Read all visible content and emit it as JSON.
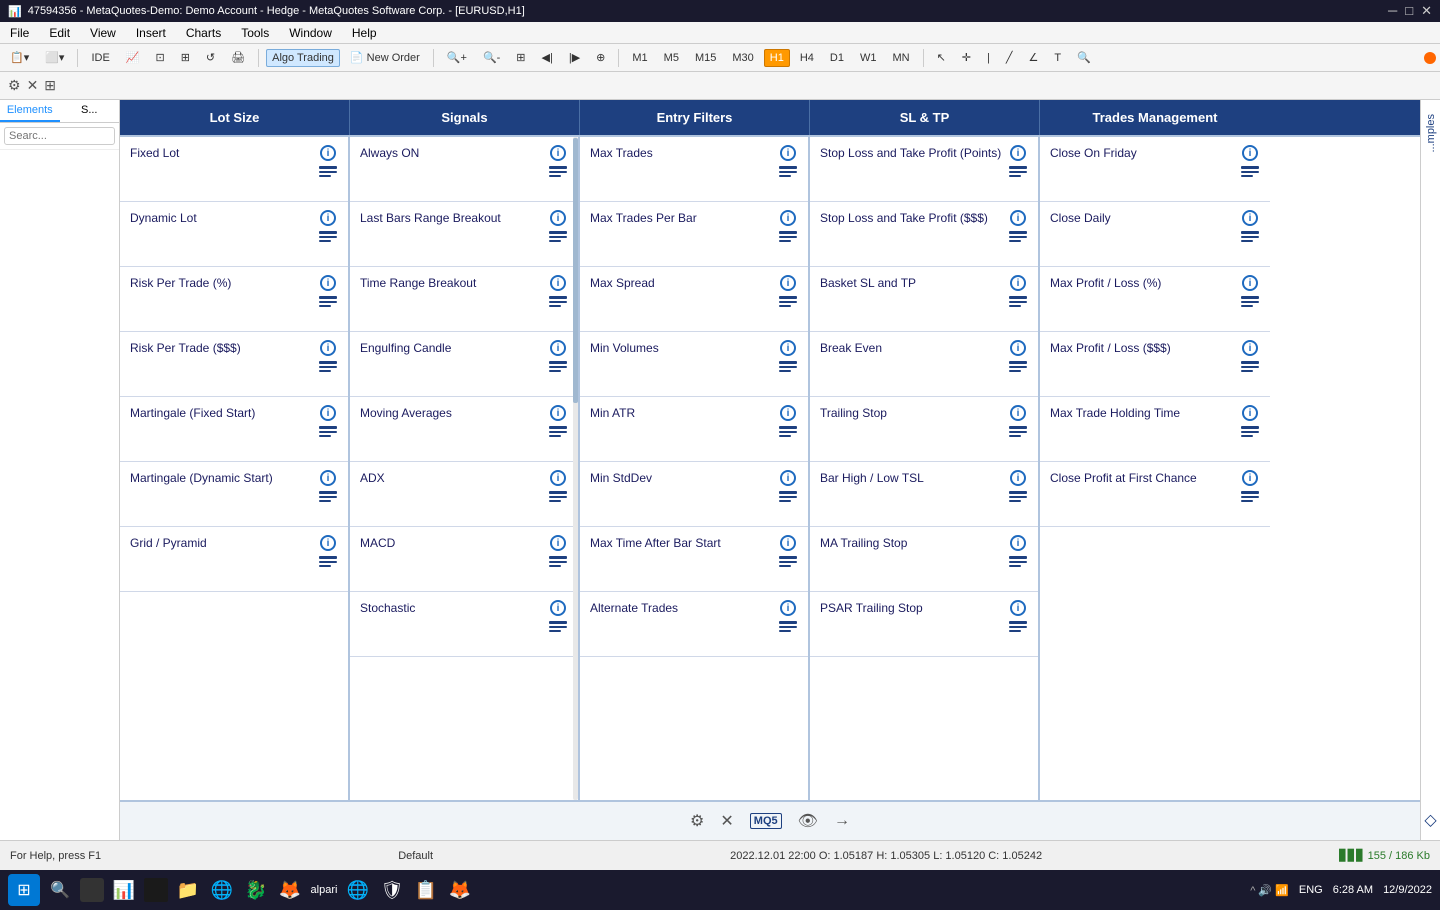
{
  "titleBar": {
    "title": "47594356 - MetaQuotes-Demo: Demo Account - Hedge - MetaQuotes Software Corp. - [EURUSD,H1]",
    "controls": [
      "─",
      "□",
      "✕"
    ]
  },
  "menuBar": {
    "items": [
      "File",
      "Edit",
      "View",
      "Insert",
      "Charts",
      "Tools",
      "Window",
      "Help"
    ]
  },
  "toolbar": {
    "timeframes": [
      "M1",
      "M5",
      "M15",
      "M30",
      "H1",
      "H4",
      "D1",
      "W1",
      "MN"
    ],
    "activeTimeframe": "H1",
    "buttons": [
      "Algo Trading",
      "New Order"
    ]
  },
  "sidebar": {
    "tabs": [
      "Elements",
      "S..."
    ],
    "searchPlaceholder": "Searc..."
  },
  "columns": {
    "headers": [
      "Lot Size",
      "Signals",
      "Entry Filters",
      "SL & TP",
      "Trades Management"
    ]
  },
  "lotSize": {
    "cells": [
      {
        "label": "Fixed Lot"
      },
      {
        "label": "Dynamic Lot"
      },
      {
        "label": "Risk Per Trade (%)"
      },
      {
        "label": "Risk Per Trade ($$$)"
      },
      {
        "label": "Martingale (Fixed Start)"
      },
      {
        "label": "Martingale (Dynamic Start)"
      },
      {
        "label": "Grid / Pyramid"
      }
    ]
  },
  "signals": {
    "cells": [
      {
        "label": "Always ON"
      },
      {
        "label": "Last Bars Range Breakout"
      },
      {
        "label": "Time Range Breakout"
      },
      {
        "label": "Engulfing Candle"
      },
      {
        "label": "Moving Averages"
      },
      {
        "label": "ADX"
      },
      {
        "label": "MACD"
      },
      {
        "label": "Stochastic"
      }
    ]
  },
  "entryFilters": {
    "cells": [
      {
        "label": "Max Trades"
      },
      {
        "label": "Max Trades Per Bar"
      },
      {
        "label": "Max Spread"
      },
      {
        "label": "Min Volumes"
      },
      {
        "label": "Min ATR"
      },
      {
        "label": "Min StdDev"
      },
      {
        "label": "Max Time After Bar Start"
      },
      {
        "label": "Alternate Trades"
      }
    ]
  },
  "sltp": {
    "cells": [
      {
        "label": "Stop Loss and Take Profit (Points)"
      },
      {
        "label": "Stop Loss and Take Profit ($$$)"
      },
      {
        "label": "Basket SL and TP"
      },
      {
        "label": "Break Even"
      },
      {
        "label": "Trailing Stop"
      },
      {
        "label": "Bar High / Low TSL"
      },
      {
        "label": "MA Trailing Stop"
      },
      {
        "label": "PSAR Trailing Stop"
      }
    ]
  },
  "tradesManagement": {
    "cells": [
      {
        "label": "Close On Friday"
      },
      {
        "label": "Close Daily"
      },
      {
        "label": "Max Profit / Loss (%)"
      },
      {
        "label": "Max Profit / Loss ($$$)"
      },
      {
        "label": "Max Trade Holding Time"
      },
      {
        "label": "Close Profit at First Chance"
      }
    ]
  },
  "bottomIcons": [
    "⚙",
    "✕",
    "MQ5",
    "👁",
    "→"
  ],
  "statusBar": {
    "left": "For Help, press F1",
    "middle": "Default",
    "ohlc": "2022.12.01 22:00   O: 1.05187   H: 1.05305   L: 1.05120   C: 1.05242"
  },
  "taskbar": {
    "time": "6:28 AM",
    "date": "12/9/2022",
    "lang": "ENG"
  }
}
